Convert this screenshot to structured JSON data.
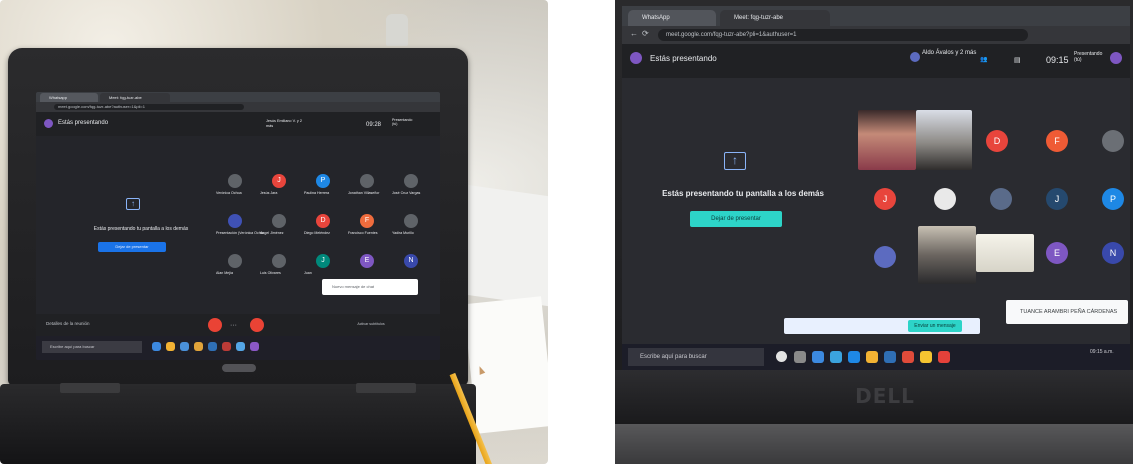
{
  "left_photo": {
    "browser": {
      "tabs": [
        "Whatsapp",
        "Meet: fqg-tuzr-abe"
      ],
      "url": "meet.google.com/fqg-tuzr-abe?authuser=1&pli=1"
    },
    "meet": {
      "presenting_label": "Estás presentando",
      "present_message": "Estás presentando tu pantalla a los demás",
      "stop_button": "Dejar de presentar",
      "participants": [
        {
          "initial": "",
          "name": "Verónica Ochoa",
          "color": "#5f6368"
        },
        {
          "initial": "J",
          "name": "Jesús Jara",
          "color": "#e8453c"
        },
        {
          "initial": "P",
          "name": "Paulina Herrera",
          "color": "#1e88e5"
        },
        {
          "initial": "",
          "name": "Jonathan Villaseñor",
          "color": "#5f6368"
        },
        {
          "initial": "",
          "name": "José Cruz Vargas",
          "color": "#5f6368"
        },
        {
          "initial": "",
          "name": "Presentación (Verónica Ochoa)",
          "color": "#3f51b5"
        },
        {
          "initial": "",
          "name": "Ángel Jiménez",
          "color": "#5f6368"
        },
        {
          "initial": "D",
          "name": "Diego Meléndez",
          "color": "#e8453c"
        },
        {
          "initial": "F",
          "name": "Francisco Fuentes",
          "color": "#ef6c3d"
        },
        {
          "initial": "",
          "name": "Yadira Murillo",
          "color": "#5f6368"
        },
        {
          "initial": "",
          "name": "Alan Mejía",
          "color": "#5f6368"
        },
        {
          "initial": "",
          "name": "Luis Olivares",
          "color": "#5f6368"
        },
        {
          "initial": "J",
          "name": "Juan",
          "color": "#00897b"
        },
        {
          "initial": "E",
          "name": "",
          "color": "#7e57c2"
        },
        {
          "initial": "N",
          "name": "",
          "color": "#3949ab"
        }
      ],
      "details_link": "Detalles de la reunión",
      "notification": "Nuevo mensaje de chat",
      "time": "09:28",
      "presenter_user": "Jesús Emiliano V. y 2 más",
      "captions_label": "Activar subtítulos",
      "presenting_badge": "Presentando (tú)"
    },
    "taskbar_search": "Escribe aquí para buscar"
  },
  "right_photo": {
    "browser": {
      "tabs": [
        "WhatsApp",
        "Meet: fqg-tuzr-abe"
      ],
      "url": "meet.google.com/fqg-tuzr-abe?pli=1&authuser=1"
    },
    "meet": {
      "presenting_label": "Estás presentando",
      "present_message": "Estás presentando tu pantalla a los demás",
      "stop_button": "Dejar de presentar",
      "presenter_user": "Aldo Ávalos y 2 más",
      "time": "09:15",
      "presenting_badge": "Presentando (tú)",
      "participants_initials": [
        "D",
        "F",
        "J",
        "J",
        "P",
        "E",
        "N"
      ],
      "notification": "TUANCE ARAMBRI PEÑA CÁRDENAS",
      "chat_send_label": "Enviar un mensaje"
    },
    "taskbar_search": "Escribe aquí para buscar",
    "tray_time": "09:15 a.m."
  },
  "colors": {
    "meet_dark": "#202124",
    "meet_bg": "#2a2b30",
    "accent_blue": "#1a73e8",
    "accent_teal": "#2dd4c8",
    "mic_red": "#ea4335"
  }
}
